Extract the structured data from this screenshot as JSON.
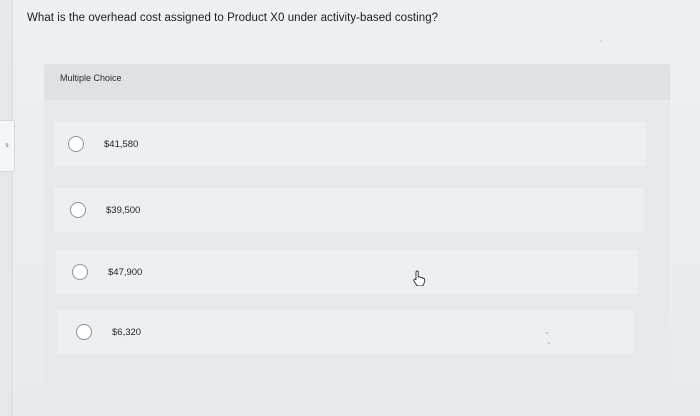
{
  "question": {
    "text": "What is the overhead cost assigned to Product X0 under activity-based costing?"
  },
  "rail": {
    "tab_text": "s"
  },
  "multiple_choice": {
    "title": "Multiple Choice",
    "options": [
      {
        "label": "$41,580"
      },
      {
        "label": "$39,500"
      },
      {
        "label": "$47,900"
      },
      {
        "label": "$6,320"
      }
    ]
  },
  "icons": {
    "cursor": "hand-pointer-icon",
    "radio": "radio-unselected-icon"
  },
  "colors": {
    "background": "#e9edf1",
    "panel": "#e6eaee",
    "option_row": "#edf0f3",
    "radio_border": "#8c949c"
  }
}
